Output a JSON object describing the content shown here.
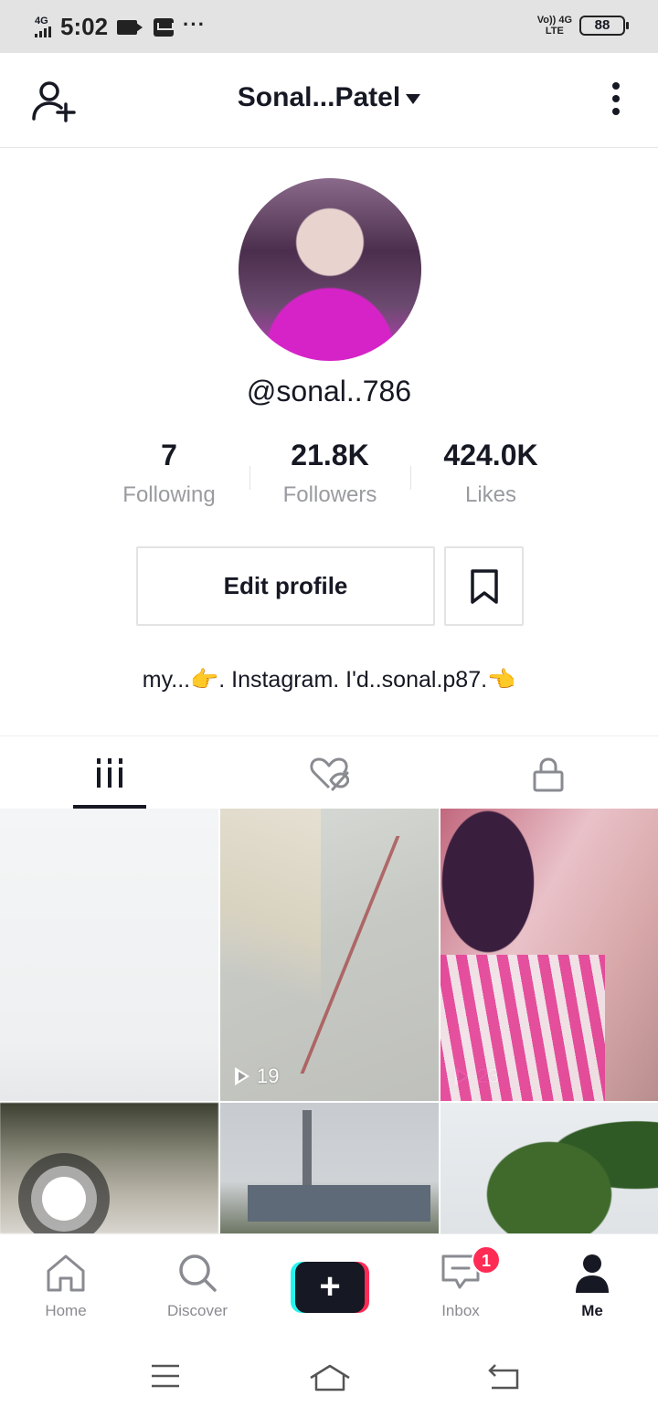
{
  "status_bar": {
    "network": "4G",
    "time": "5:02",
    "overflow": "···",
    "lte_top": "Vo)) 4G",
    "lte_bottom": "LTE",
    "battery": "88"
  },
  "header": {
    "title": "Sonal...Patel"
  },
  "profile": {
    "username": "@sonal..786",
    "stats": [
      {
        "value": "7",
        "label": "Following"
      },
      {
        "value": "21.8K",
        "label": "Followers"
      },
      {
        "value": "424.0K",
        "label": "Likes"
      }
    ],
    "edit_button": "Edit profile",
    "bio": "my...👉. Instagram. I'd..sonal.p87.👈"
  },
  "videos": [
    {
      "views": ""
    },
    {
      "views": "19"
    },
    {
      "views": "23"
    }
  ],
  "bottom_nav": {
    "items": [
      {
        "label": "Home",
        "icon": "home-icon"
      },
      {
        "label": "Discover",
        "icon": "search-icon"
      },
      {
        "label": "",
        "icon": "plus-icon"
      },
      {
        "label": "Inbox",
        "icon": "inbox-icon"
      },
      {
        "label": "Me",
        "icon": "person-icon"
      }
    ],
    "inbox_badge": "1"
  },
  "colors": {
    "accent_red": "#fe2c55",
    "accent_cyan": "#25f4ee",
    "text_primary": "#161823",
    "text_secondary": "#9a9ba0"
  }
}
